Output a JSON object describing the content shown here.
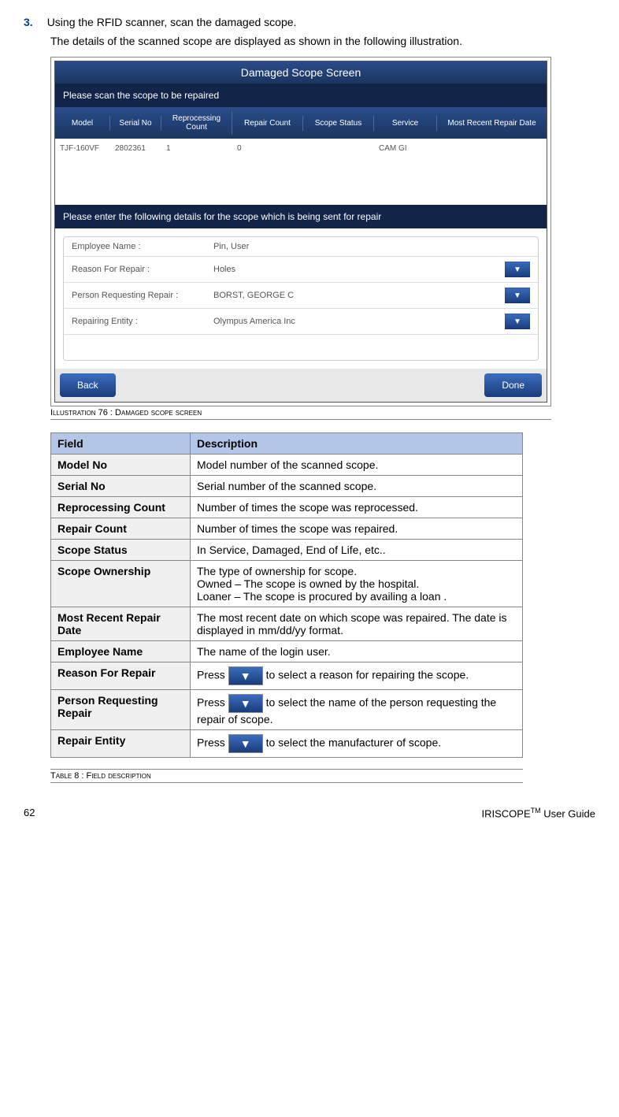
{
  "step": {
    "number": "3.",
    "text": "Using the RFID scanner, scan the damaged scope.",
    "para": "The details of the scanned scope are displayed as shown in the following illustration."
  },
  "screenshot": {
    "header": "Damaged Scope Screen",
    "scan_prompt": "Please scan the scope to be repaired",
    "columns": {
      "model": "Model",
      "serial": "Serial No",
      "reproc": "Reprocessing Count",
      "repair": "Repair Count",
      "status": "Scope Status",
      "service": "Service",
      "recent": "Most Recent Repair Date"
    },
    "row": {
      "model": "TJF-160VF",
      "serial": "2802361",
      "reproc": "1",
      "repair": "0",
      "status": "",
      "service": "CAM GI",
      "recent": ""
    },
    "form_prompt": "Please enter the following details for the scope which is being sent for repair",
    "form": {
      "employee_label": "Employee Name :",
      "employee_value": "Pin, User",
      "reason_label": "Reason For Repair :",
      "reason_value": "Holes",
      "person_label": "Person Requesting Repair :",
      "person_value": "BORST, GEORGE C",
      "entity_label": "Repairing Entity :",
      "entity_value": "Olympus America Inc"
    },
    "back_button": "Back",
    "done_button": "Done"
  },
  "illustration_caption": "Illustration 76 : Damaged scope screen",
  "table": {
    "header_field": "Field",
    "header_desc": "Description",
    "rows": [
      {
        "field": "Model No",
        "desc": "Model number of the scanned scope."
      },
      {
        "field": "Serial No",
        "desc": "Serial number of the scanned scope."
      },
      {
        "field": "Reprocessing Count",
        "desc": "Number of times the scope was reprocessed."
      },
      {
        "field": "Repair Count",
        "desc": "Number of times the scope was repaired."
      },
      {
        "field": "Scope Status",
        "desc": "In Service, Damaged, End of Life, etc.."
      },
      {
        "field": "Scope Ownership",
        "desc": "The type of ownership for scope.\nOwned – The scope is owned by the hospital.\nLoaner –  The  scope is procured by availing a loan ."
      },
      {
        "field": "Most Recent Repair Date",
        "desc": "The most recent date on which scope was repaired. The  date is displayed in mm/dd/yy format."
      },
      {
        "field": "Employee Name",
        "desc": "The name of the login user."
      }
    ],
    "reason_field": "Reason For Repair",
    "reason_pre": "Press ",
    "reason_post": " to select a reason for repairing the scope.",
    "person_field": "Person Requesting Repair",
    "person_pre": "Press ",
    "person_post": " to select the name of the person requesting the repair of scope.",
    "entity_field": "Repair Entity",
    "entity_pre": "Press ",
    "entity_post": " to select the manufacturer of scope."
  },
  "table_caption": "Table 8 :   Field description",
  "footer": {
    "page": "62",
    "brand_pre": "IRISCOPE",
    "brand_tm": "TM",
    "brand_post": " User Guide"
  }
}
